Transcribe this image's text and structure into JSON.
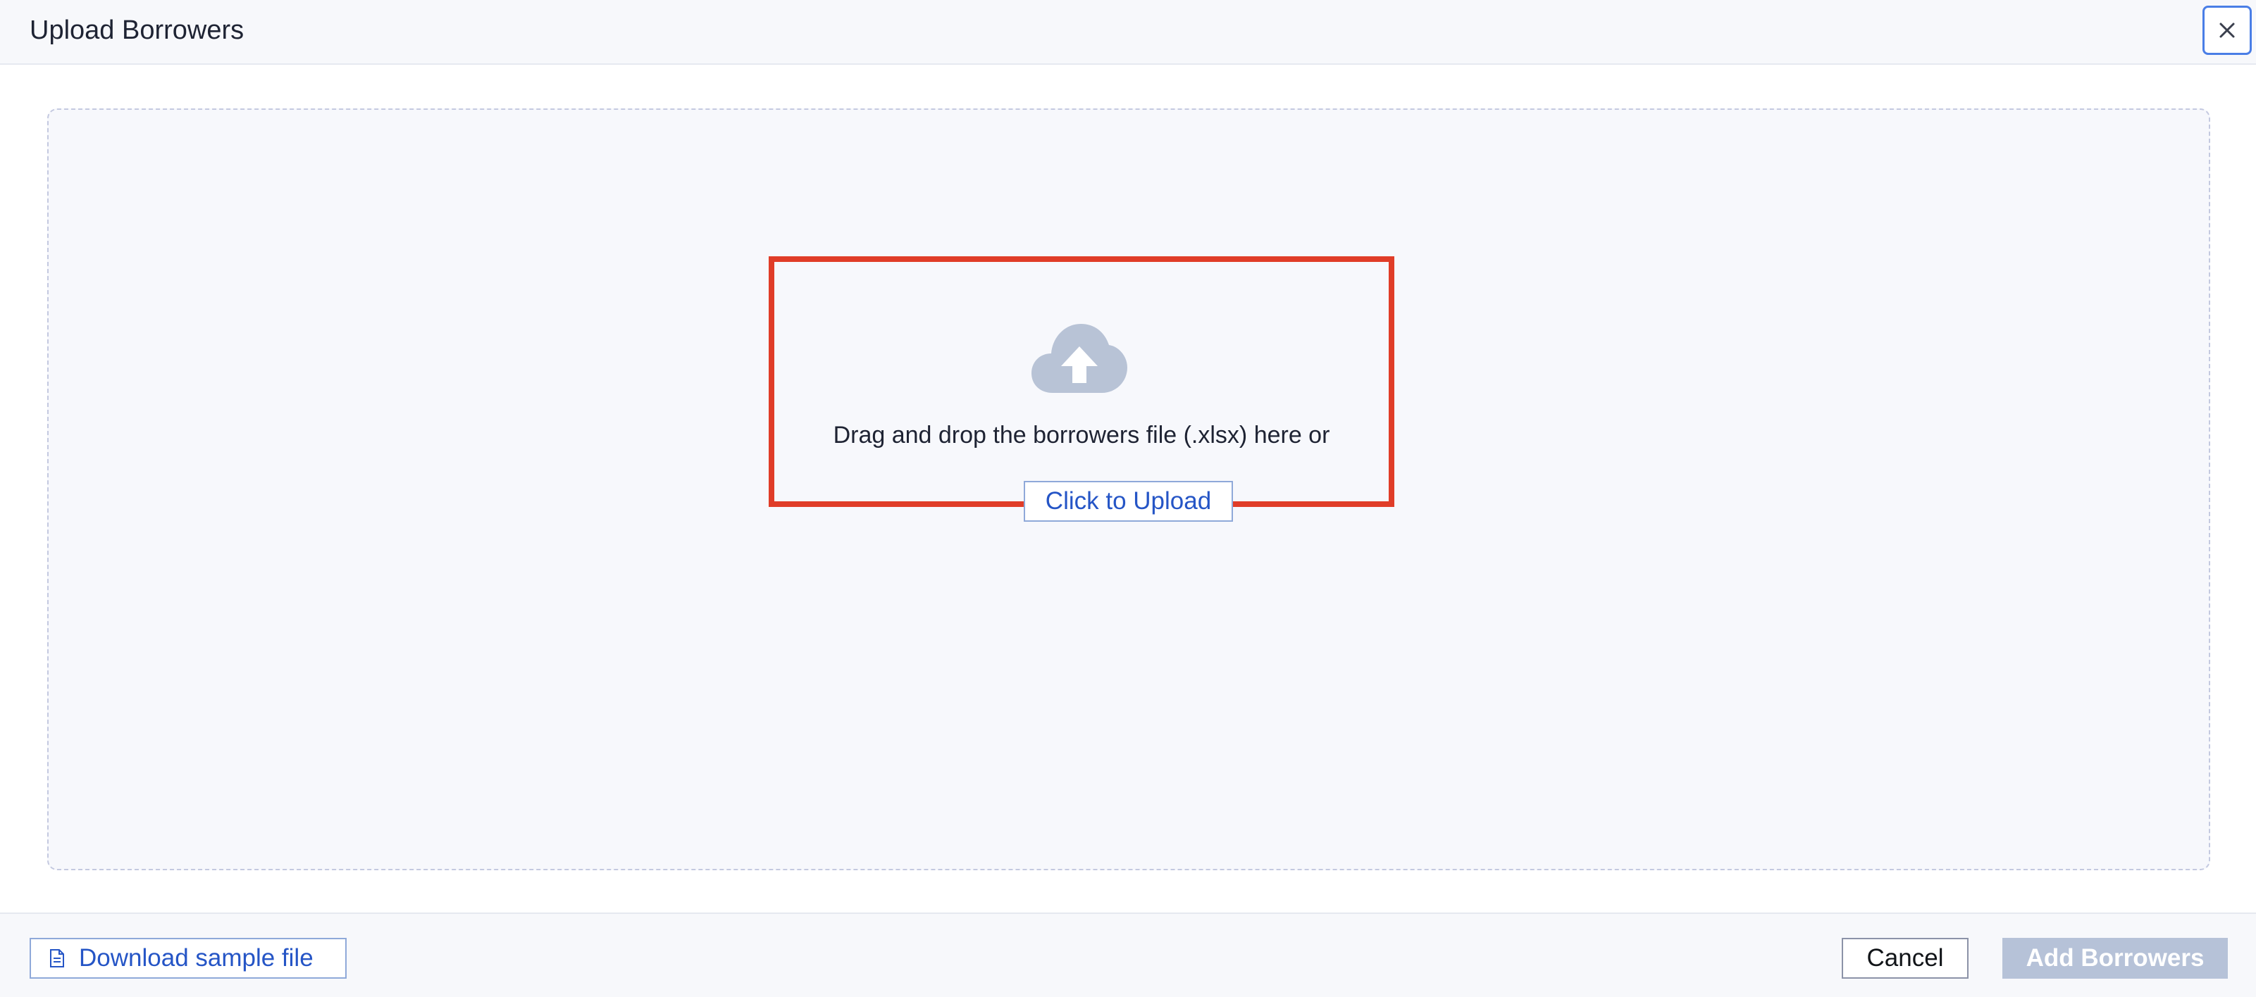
{
  "dialog": {
    "title": "Upload Borrowers",
    "close_icon": "close-icon"
  },
  "dropzone": {
    "icon": "cloud-upload-icon",
    "instruction": "Drag and drop the borrowers file (.xlsx) here or",
    "upload_button_label": "Click to Upload",
    "highlight_color": "#e03d28"
  },
  "footer": {
    "download_icon": "file-icon",
    "download_label": "Download sample file",
    "cancel_label": "Cancel",
    "add_label": "Add Borrowers"
  },
  "colors": {
    "accent": "#2555c6",
    "disabled_button": "#b6c2d8",
    "icon_gray": "#b8c3d6"
  }
}
